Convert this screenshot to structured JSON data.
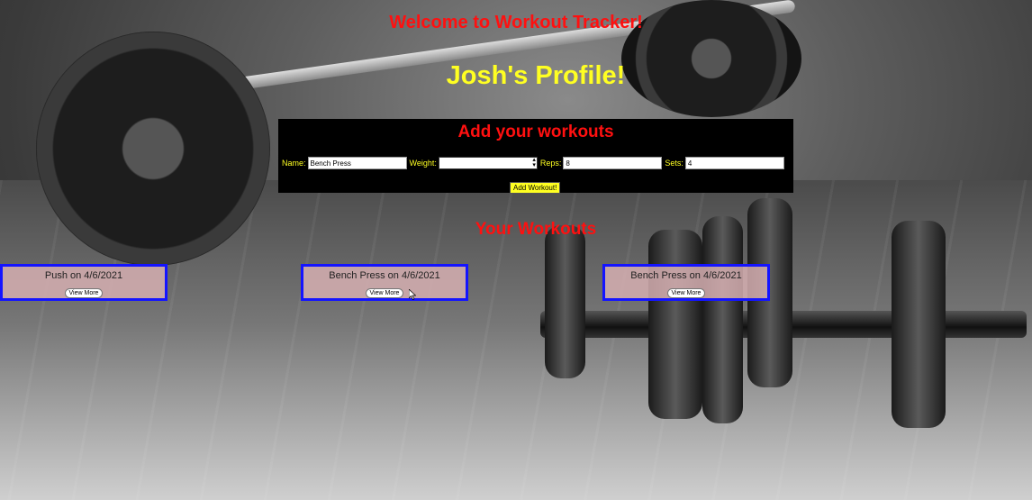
{
  "header": {
    "welcome": "Welcome to Workout Tracker!",
    "profile_title": "Josh's Profile!"
  },
  "form": {
    "title": "Add your workouts",
    "name_label": "Name:",
    "name_value": "Bench Press",
    "weight_label": "Weight:",
    "weight_value": "",
    "reps_label": "Reps:",
    "reps_value": "8",
    "sets_label": "Sets:",
    "sets_value": "4",
    "submit_label": "Add Workout!"
  },
  "workouts": {
    "title": "Your Workouts",
    "cards": [
      {
        "title": "Push on 4/6/2021",
        "button": "View More"
      },
      {
        "title": "Bench Press on 4/6/2021",
        "button": "View More"
      },
      {
        "title": "Bench Press on 4/6/2021",
        "button": "View More"
      }
    ]
  },
  "colors": {
    "heading_red": "#ff1010",
    "heading_yellow": "#ffff22",
    "card_border": "#1414ff",
    "card_bg": "#d6afb2"
  },
  "icons": {
    "weight_select": "chevron-updown-icon",
    "cursor": "mouse-pointer-icon"
  }
}
